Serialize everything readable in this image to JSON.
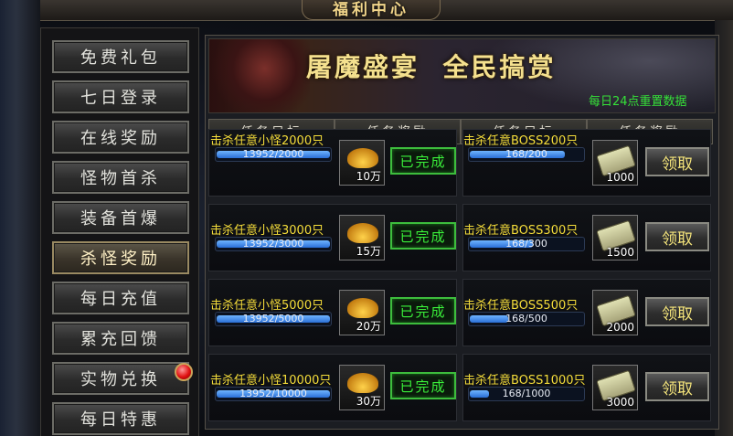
{
  "window": {
    "title": "福利中心"
  },
  "sidebar": {
    "items": [
      {
        "label": "免费礼包"
      },
      {
        "label": "七日登录"
      },
      {
        "label": "在线奖励"
      },
      {
        "label": "怪物首杀"
      },
      {
        "label": "装备首爆"
      },
      {
        "label": "杀怪奖励",
        "active": true
      },
      {
        "label": "每日充值"
      },
      {
        "label": "累充回馈"
      },
      {
        "label": "实物兑换",
        "notification": true
      },
      {
        "label": "每日特惠"
      }
    ]
  },
  "banner": {
    "title": "屠魔盛宴  全民搞赏",
    "note": "每日24点重置数据"
  },
  "table": {
    "headers": [
      "任务目标",
      "任务奖励",
      "任务目标",
      "任务奖励"
    ],
    "rows": [
      {
        "left": {
          "task": "击杀任意小怪2000只",
          "progress_text": "13952/2000",
          "progress": 1.0,
          "reward_icon": "gold-ingot-icon",
          "reward_qty": "10万",
          "status": "已完成"
        },
        "right": {
          "task": "击杀任意BOSS200只",
          "progress_text": "168/200",
          "progress": 0.84,
          "reward_icon": "scroll-icon",
          "reward_qty": "1000",
          "action": "领取"
        }
      },
      {
        "left": {
          "task": "击杀任意小怪3000只",
          "progress_text": "13952/3000",
          "progress": 1.0,
          "reward_icon": "gold-ingot-icon",
          "reward_qty": "15万",
          "status": "已完成"
        },
        "right": {
          "task": "击杀任意BOSS300只",
          "progress_text": "168/300",
          "progress": 0.56,
          "reward_icon": "scroll-icon",
          "reward_qty": "1500",
          "action": "领取"
        }
      },
      {
        "left": {
          "task": "击杀任意小怪5000只",
          "progress_text": "13952/5000",
          "progress": 1.0,
          "reward_icon": "gold-ingot-icon",
          "reward_qty": "20万",
          "status": "已完成"
        },
        "right": {
          "task": "击杀任意BOSS500只",
          "progress_text": "168/500",
          "progress": 0.336,
          "reward_icon": "scroll-icon",
          "reward_qty": "2000",
          "action": "领取"
        }
      },
      {
        "left": {
          "task": "击杀任意小怪10000只",
          "progress_text": "13952/10000",
          "progress": 1.0,
          "reward_icon": "gold-ingot-icon",
          "reward_qty": "30万",
          "status": "已完成"
        },
        "right": {
          "task": "击杀任意BOSS1000只",
          "progress_text": "168/1000",
          "progress": 0.168,
          "reward_icon": "scroll-icon",
          "reward_qty": "3000",
          "action": "领取"
        }
      }
    ]
  },
  "colors": {
    "task_text": "#f5dd3a",
    "progress_fill": "#2a6fd6",
    "done": "#3af03a",
    "note": "#35e038"
  }
}
